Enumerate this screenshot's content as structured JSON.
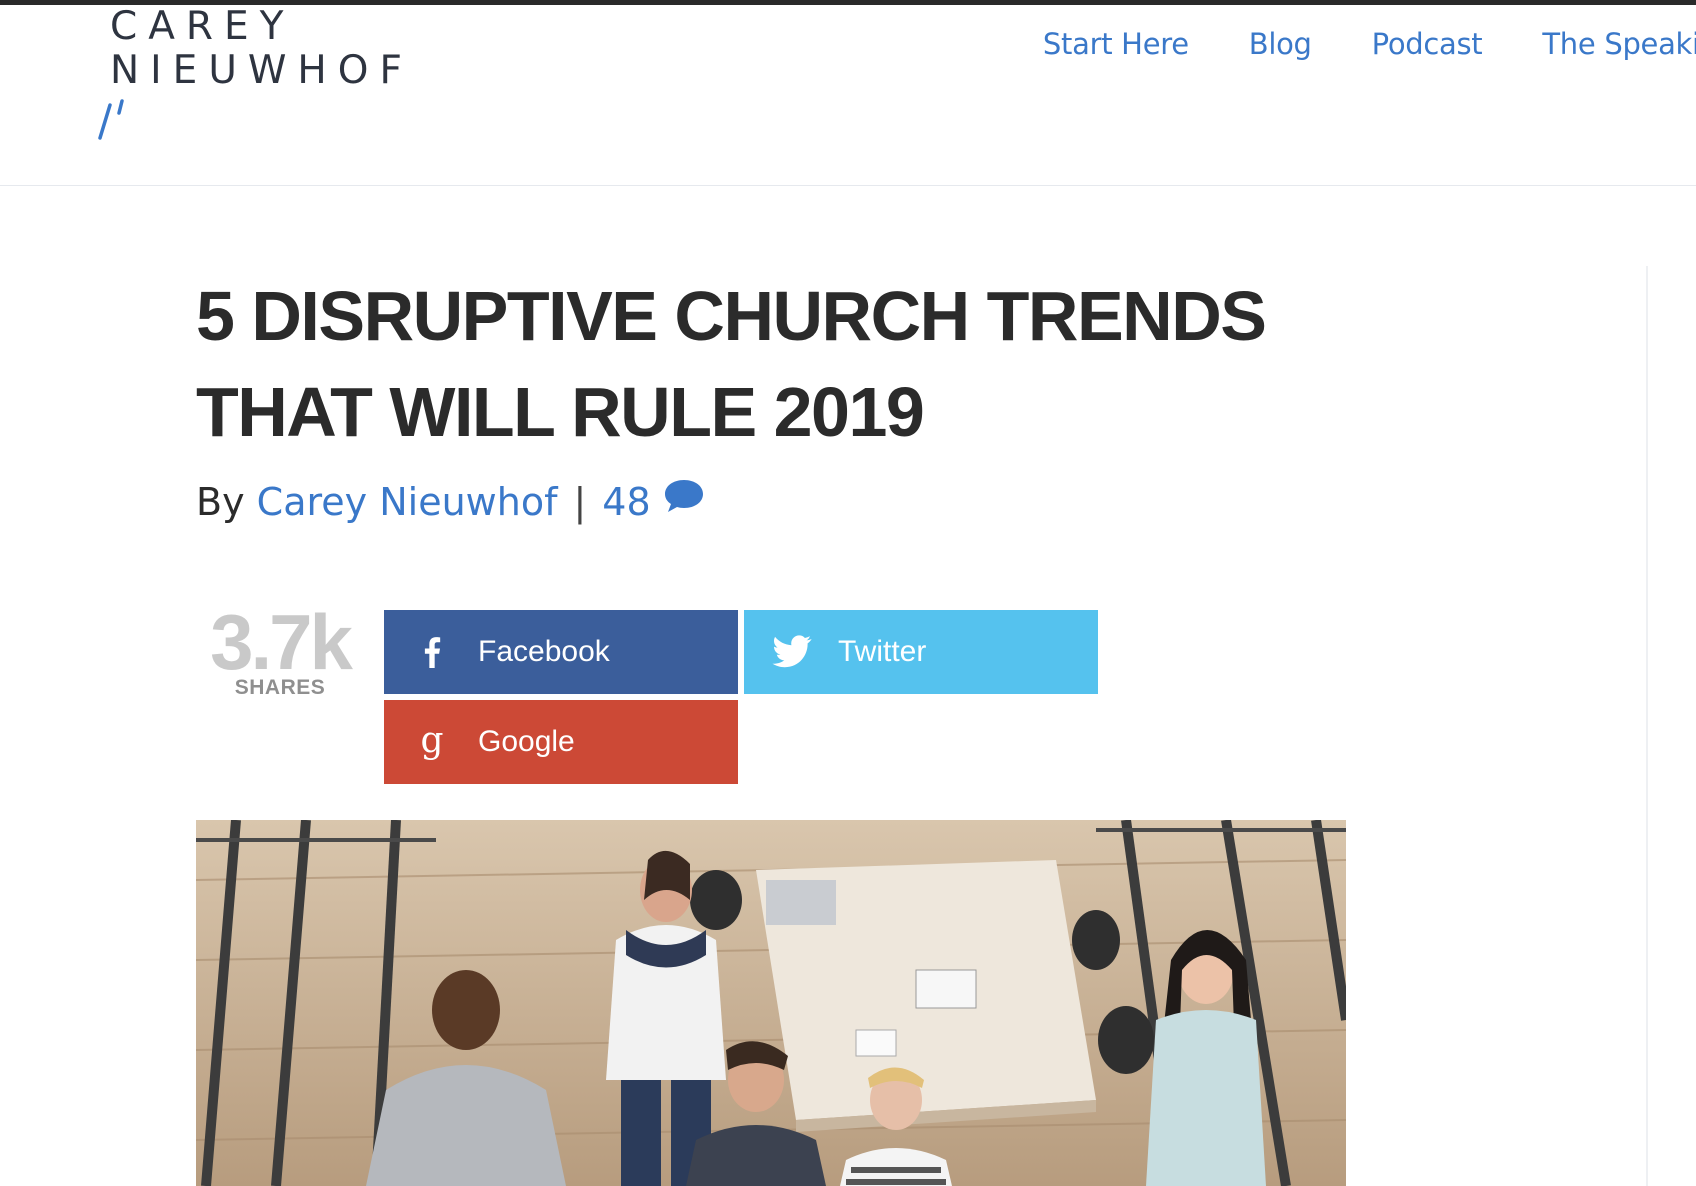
{
  "header": {
    "logo_line1": "CAREY",
    "logo_line2": "NIEUWHOF",
    "nav": [
      {
        "label": "Start Here"
      },
      {
        "label": "Blog"
      },
      {
        "label": "Podcast"
      },
      {
        "label": "The Speaking"
      }
    ]
  },
  "post": {
    "title": "5 DISRUPTIVE CHURCH TRENDS THAT WILL RULE 2019",
    "byline": {
      "prefix": "By",
      "author": "Carey Nieuwhof",
      "separator": "|",
      "comment_count": "48"
    }
  },
  "share": {
    "count": "3.7k",
    "count_label": "SHARES",
    "buttons": {
      "facebook": "Facebook",
      "twitter": "Twitter",
      "google": "Google"
    },
    "colors": {
      "facebook": "#3b5e9b",
      "twitter": "#55c2ee",
      "google": "#cc4936"
    }
  },
  "featured_image": {
    "icon": "photo-of-team-in-office"
  },
  "theme": {
    "link_color": "#3a78c9",
    "text_color": "#2b2b2b"
  }
}
